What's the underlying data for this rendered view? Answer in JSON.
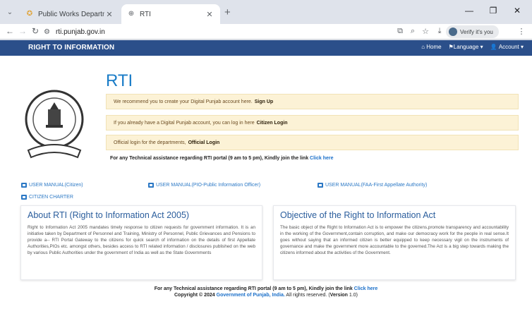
{
  "browser": {
    "tabs": [
      {
        "title": "Public Works Department, Pun",
        "active": false
      },
      {
        "title": "RTI",
        "active": true
      }
    ],
    "url": "rti.punjab.gov.in",
    "verify_label": "Verify it's you"
  },
  "nav": {
    "brand": "RIGHT TO INFORMATION",
    "home": "Home",
    "language": "Language",
    "account": "Account"
  },
  "main": {
    "title": "RTI",
    "emblem_text": "GOVT. OF PUNJAB",
    "notices": [
      {
        "text": "We recommend you to create your Digital Punjab account here.",
        "link": "Sign Up"
      },
      {
        "text": "If you already have a Digital Punjab account, you can log in here",
        "link": "Citizen Login"
      },
      {
        "text": "Official login for the departments,",
        "link": "Official Login"
      }
    ],
    "tech_assist": "For any Technical assistance regarding RTI portal (9 am to 5 pm), Kindly join the link",
    "tech_link": "Click here"
  },
  "manuals": [
    "USER MANUAL(Citizen)",
    "USER MANUAL(PIO-Public Information Officer)",
    "USER MANUAL(FAA-First Appellate Authority)",
    "CITIZEN CHARTER"
  ],
  "about": {
    "title": "About RTI (Right to Information Act 2005)",
    "body": "Right to Information Act 2005 mandates timely response to citizen requests for government information. It is an initiative taken by Department of Personnel and Training, Ministry of Personnel, Public Grievances and Pensions to provide a-- RTI Portal Gateway to the citizens for quick search of information on the details of first Appellate Authorities,PIOs etc. amongst others, besides access to RTI related information / disclosures published on the web by various Public Authorities under the government of India as well as the State Governments"
  },
  "objective": {
    "title": "Objective of the Right to Information Act",
    "body": "The basic object of the Right to Information Act is to empower the citizens,promote transparency and accountability in the working of the Government,contain corruption, and make our democracy work for the people in real sense.It goes without saying that an informed citizen is better equipped to keep necessary vigil on the instruments of governance and make the government more accountable to the governed.The Act is a big step towards making the citizens informed about the activities of the Government."
  },
  "footer": {
    "line1": "For any Technical assistance regarding RTI portal (9 am to 5 pm), Kindly join the link",
    "line1_link": "Click here",
    "copyright": "Copyright © 2024",
    "org": "Government of Punjab, India.",
    "rights": "All rights reserved. (",
    "version_label": "Version",
    "version": "1.0",
    "close_paren": ")"
  }
}
